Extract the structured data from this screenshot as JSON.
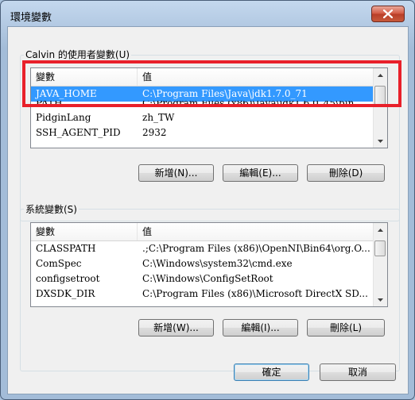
{
  "window": {
    "title": "環境變數",
    "close_icon": "close-icon"
  },
  "user_vars": {
    "group_label": "Calvin 的使用者變數(U)",
    "columns": [
      "變數",
      "值"
    ],
    "rows": [
      {
        "name": "JAVA_HOME",
        "value": "C:\\Program Files\\Java\\jdk1.7.0_71",
        "selected": true
      },
      {
        "name": "PATH",
        "value": "C:\\Program Files (x86)\\Java\\jdk1.6.0_45\\bin"
      },
      {
        "name": "PidginLang",
        "value": "zh_TW"
      },
      {
        "name": "SSH_AGENT_PID",
        "value": "2932"
      }
    ],
    "buttons": {
      "new": "新增(N)...",
      "edit": "編輯(E)...",
      "delete": "刪除(D)"
    }
  },
  "system_vars": {
    "group_label": "系統變數(S)",
    "columns": [
      "變數",
      "值"
    ],
    "rows": [
      {
        "name": "CLASSPATH",
        "value": ".;C:\\Program Files (x86)\\OpenNI\\Bin64\\org.O..."
      },
      {
        "name": "ComSpec",
        "value": "C:\\Windows\\system32\\cmd.exe"
      },
      {
        "name": "configsetroot",
        "value": "C:\\Windows\\ConfigSetRoot"
      },
      {
        "name": "DXSDK_DIR",
        "value": "C:\\Program Files (x86)\\Microsoft DirectX SD..."
      }
    ],
    "buttons": {
      "new": "新增(W)...",
      "edit": "編輯(I)...",
      "delete": "刪除(L)"
    }
  },
  "footer": {
    "ok": "確定",
    "cancel": "取消"
  },
  "colors": {
    "selection": "#3399ff",
    "highlight_box": "#e8202a"
  }
}
